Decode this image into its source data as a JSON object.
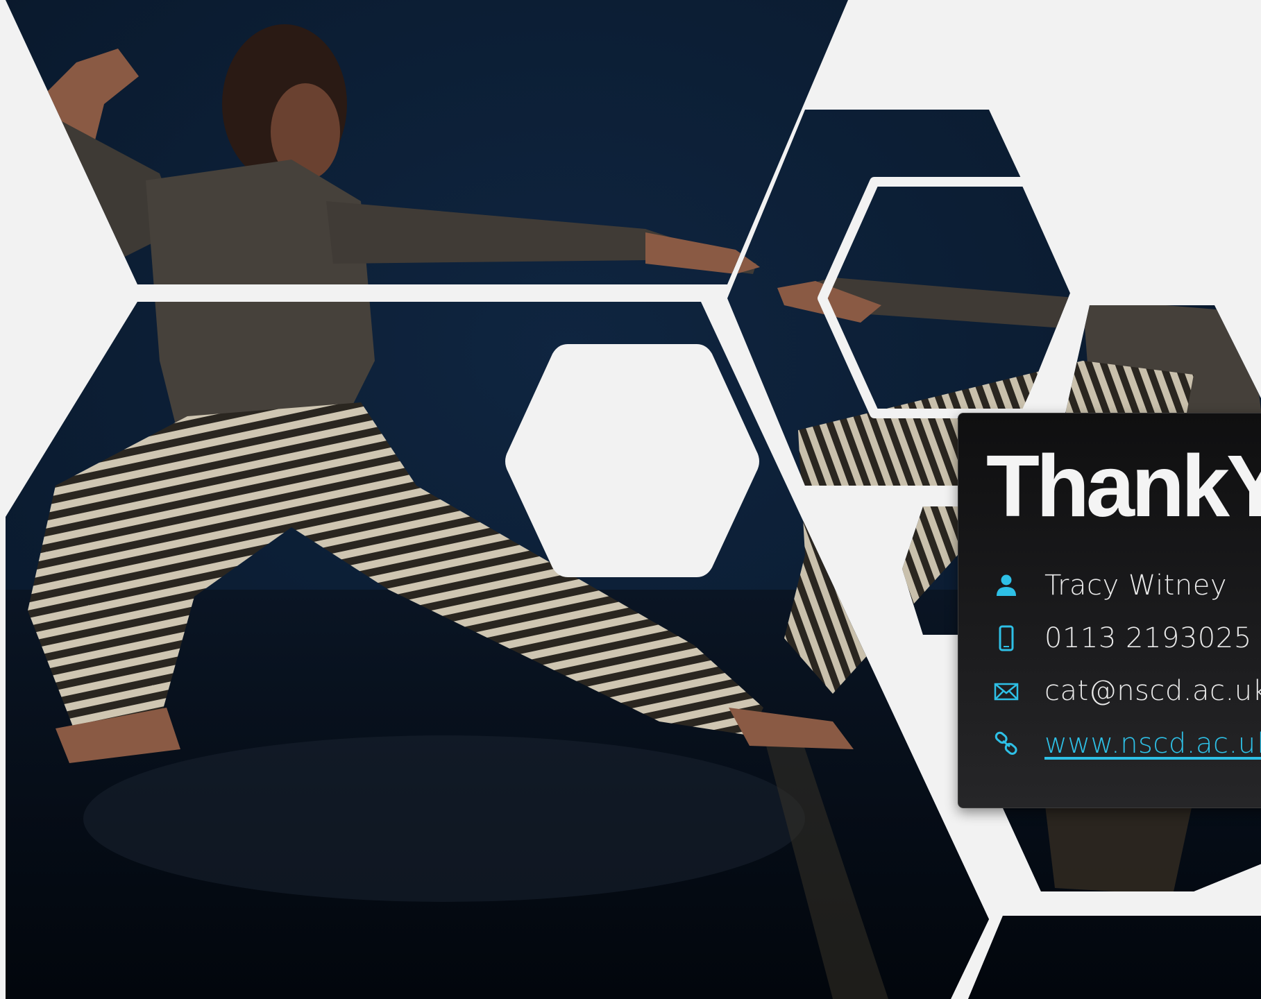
{
  "slide": {
    "title": "ThankYou",
    "accent_color": "#2ec0e6",
    "photo_subject": "dancer-lunge-striped-trousers"
  },
  "contacts": [
    {
      "icon": "person-icon",
      "text": "Tracy Witney",
      "kind": "name"
    },
    {
      "icon": "mobile-phone-icon",
      "text": "0113 2193025",
      "kind": "phone"
    },
    {
      "icon": "envelope-icon",
      "text": "cat@nscd.ac.uk",
      "kind": "email"
    },
    {
      "icon": "link-icon",
      "text": "www.nscd.ac.uk",
      "kind": "website"
    }
  ]
}
